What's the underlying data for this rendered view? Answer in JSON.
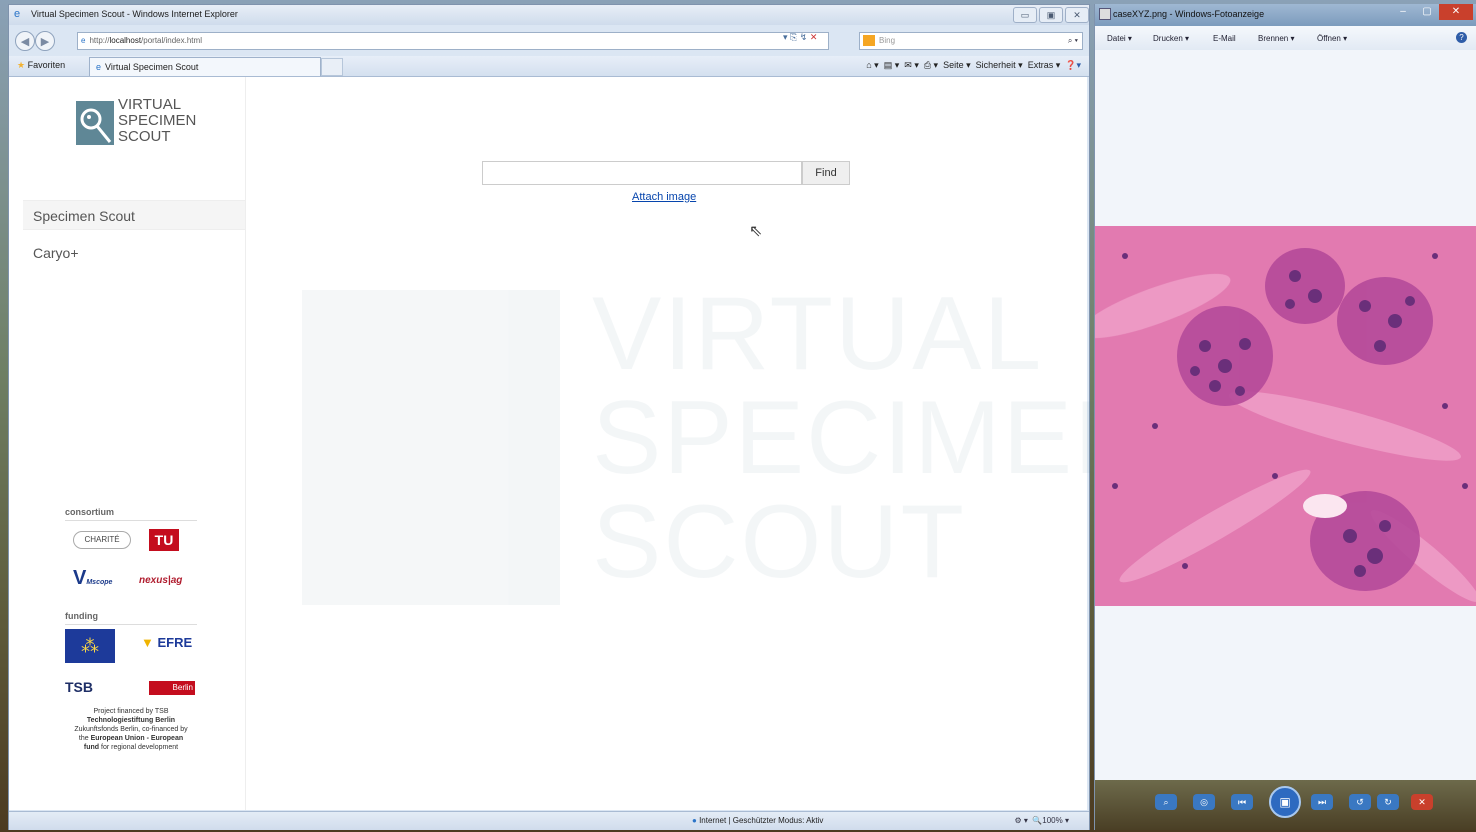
{
  "ie": {
    "title": "Virtual Specimen Scout - Windows Internet Explorer",
    "address_prefix": "http://",
    "address_host": "localhost",
    "address_path": "/portal/index.html",
    "search_engine": "Bing",
    "favorites_label": "Favoriten",
    "tab_title": "Virtual Specimen Scout",
    "cmd_seite": "Seite ▾",
    "cmd_sicherheit": "Sicherheit ▾",
    "cmd_extras": "Extras ▾",
    "status_zone": "Internet | Geschützter Modus: Aktiv",
    "zoom": "100%"
  },
  "page": {
    "logo_text": "VIRTUAL\nSPECIMEN\nSCOUT",
    "menu": [
      {
        "label": "Specimen Scout",
        "selected": true
      },
      {
        "label": "Caryo+",
        "selected": false
      }
    ],
    "search_value": "",
    "find_label": "Find",
    "attach_label": "Attach image",
    "consortium_heading": "consortium",
    "funding_heading": "funding",
    "consortium_logos": {
      "charite": "CHARITÉ",
      "tu": "TU",
      "vm": "V",
      "vm_sub": "Mscope",
      "nexus": "nexus|ag"
    },
    "funding_logos": {
      "efre": "EFRE",
      "tsb": "TSB",
      "berlin": "Berlin"
    },
    "finance_line1": "Project financed by TSB",
    "finance_line2": "Technologiestiftung Berlin",
    "finance_line3": "Zukunftsfonds Berlin, co-financed by",
    "finance_line4_a": "the ",
    "finance_line4_b": "European Union - European",
    "finance_line5_a": "fund",
    "finance_line5_b": " for regional development",
    "watermark_text": "VIRTUAL\nSPECIMEN\nSCOUT"
  },
  "viewer": {
    "title": "caseXYZ.png - Windows-Fotoanzeige",
    "menu": [
      "Datei ▾",
      "Drucken ▾",
      "E-Mail",
      "Brennen ▾",
      "Öffnen ▾"
    ],
    "tissue_colors": [
      "#e27ab0",
      "#6a2f7a",
      "#b54a9a"
    ]
  }
}
